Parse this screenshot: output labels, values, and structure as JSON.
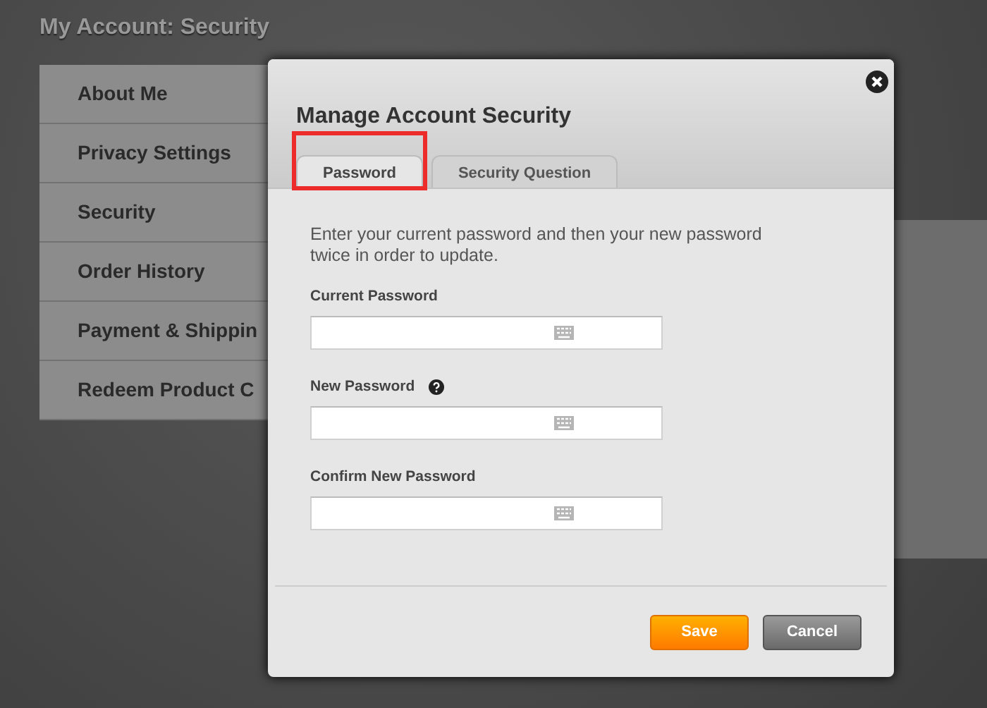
{
  "page_title": "My Account: Security",
  "sidebar": {
    "items": [
      {
        "label": "About Me"
      },
      {
        "label": "Privacy Settings"
      },
      {
        "label": "Security"
      },
      {
        "label": "Order History"
      },
      {
        "label": "Payment & Shippin"
      },
      {
        "label": "Redeem Product C"
      }
    ]
  },
  "dialog": {
    "title": "Manage Account Security",
    "tabs": [
      {
        "label": "Password",
        "selected": true,
        "highlighted": true
      },
      {
        "label": "Security Question",
        "selected": false,
        "highlighted": false
      }
    ],
    "intro": "Enter your current password and then your new password twice in order to update.",
    "fields": [
      {
        "label": "Current Password",
        "help": false
      },
      {
        "label": "New Password",
        "help": true
      },
      {
        "label": "Confirm New Password",
        "help": false
      }
    ],
    "buttons": [
      {
        "label": "Save",
        "kind": "primary"
      },
      {
        "label": "Cancel",
        "kind": "secondary"
      }
    ]
  }
}
